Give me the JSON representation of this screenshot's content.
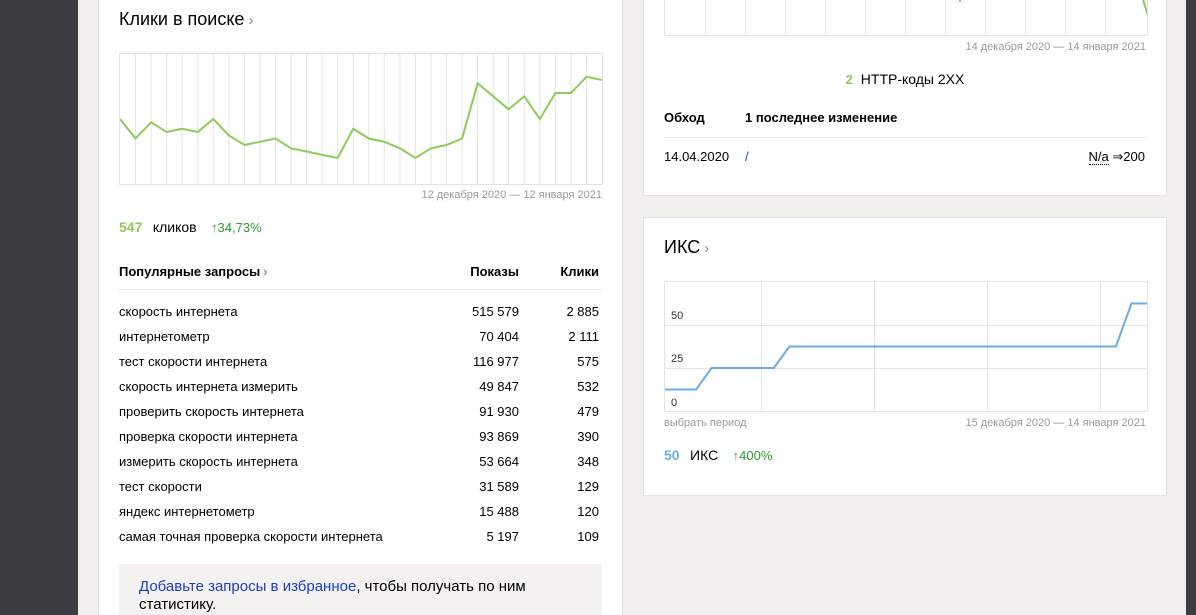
{
  "clicks_card": {
    "title": "Клики в поиске",
    "chevron": "›",
    "period": "12 декабря 2020 — 12 января 2021",
    "total_value": "547",
    "total_label": "кликов",
    "growth": "↑34,73%",
    "table": {
      "header_query": "Популярные запросы",
      "header_query_chevron": "›",
      "header_shows": "Показы",
      "header_clicks": "Клики",
      "rows": [
        {
          "query": "скорость интернета",
          "shows": "515 579",
          "clicks": "2 885"
        },
        {
          "query": "интернетометр",
          "shows": "70 404",
          "clicks": "2 111"
        },
        {
          "query": "тест скорости интернета",
          "shows": "116 977",
          "clicks": "575"
        },
        {
          "query": "скорость интернета измерить",
          "shows": "49 847",
          "clicks": "532"
        },
        {
          "query": "проверить скорость интернета",
          "shows": "91 930",
          "clicks": "479"
        },
        {
          "query": "проверка скорости интернета",
          "shows": "93 869",
          "clicks": "390"
        },
        {
          "query": "измерить скорость интернета",
          "shows": "53 664",
          "clicks": "348"
        },
        {
          "query": "тест скорости",
          "shows": "31 589",
          "clicks": "129"
        },
        {
          "query": "яндекс интернетометр",
          "shows": "15 488",
          "clicks": "120"
        },
        {
          "query": "самая точная проверка скорости интернета",
          "shows": "5 197",
          "clicks": "109"
        }
      ]
    },
    "favorites": {
      "link_text": "Добавьте запросы в избранное",
      "rest_text": ", чтобы получать по ним статистику."
    }
  },
  "http_card": {
    "period": "14 декабря 2020 — 14 января 2021",
    "codes_count": "2",
    "codes_label": "HTTP-коды 2XX",
    "crawl_label": "Обход",
    "last_change_label": "1 последнее изменение",
    "row": {
      "date": "14.04.2020",
      "link": "/",
      "status_from": "N/a",
      "arrow": "⇒",
      "status_to": "200"
    }
  },
  "iks_card": {
    "title": "ИКС",
    "chevron": "›",
    "y_ticks": [
      "50",
      "25",
      "0"
    ],
    "select_period": "выбрать период",
    "period": "15 декабря 2020 — 14 января 2021",
    "value": "50",
    "label": "ИКС",
    "growth": "↑400%"
  },
  "colors": {
    "clicks_line": "#8ccc5a",
    "iks_line": "#6aade4",
    "growth_green": "#2a9d2a",
    "link_blue": "#1a3dcc"
  },
  "chart_data": [
    {
      "type": "line",
      "title": "Клики в поиске",
      "series": [
        {
          "values": [
            20,
            14,
            19,
            16,
            17,
            16,
            20,
            15,
            12,
            13,
            14,
            11,
            10,
            9,
            8,
            17,
            14,
            13,
            11,
            8,
            11,
            12,
            14,
            31,
            27,
            23,
            27,
            20,
            28,
            28,
            33,
            32
          ]
        }
      ],
      "grid": true
    },
    {
      "type": "line",
      "title": "ИКС",
      "x": [
        0,
        1,
        2,
        3,
        4,
        5,
        6,
        7,
        8,
        9,
        10,
        11,
        12,
        13,
        14,
        15,
        16,
        17,
        18,
        19,
        20,
        21,
        22,
        23,
        24,
        25,
        26,
        27,
        28,
        29,
        30,
        31
      ],
      "series": [
        {
          "name": "ИКС",
          "values": [
            10,
            10,
            10,
            20,
            20,
            20,
            20,
            20,
            30,
            30,
            30,
            30,
            30,
            30,
            30,
            30,
            30,
            30,
            30,
            30,
            30,
            30,
            30,
            30,
            30,
            30,
            30,
            30,
            30,
            30,
            50,
            50
          ]
        }
      ],
      "y_ticks": [
        0,
        25,
        50
      ],
      "ylim": [
        0,
        60
      ],
      "grid": true
    },
    {
      "type": "line",
      "title": "HTTP-коды",
      "grid": true
    }
  ]
}
